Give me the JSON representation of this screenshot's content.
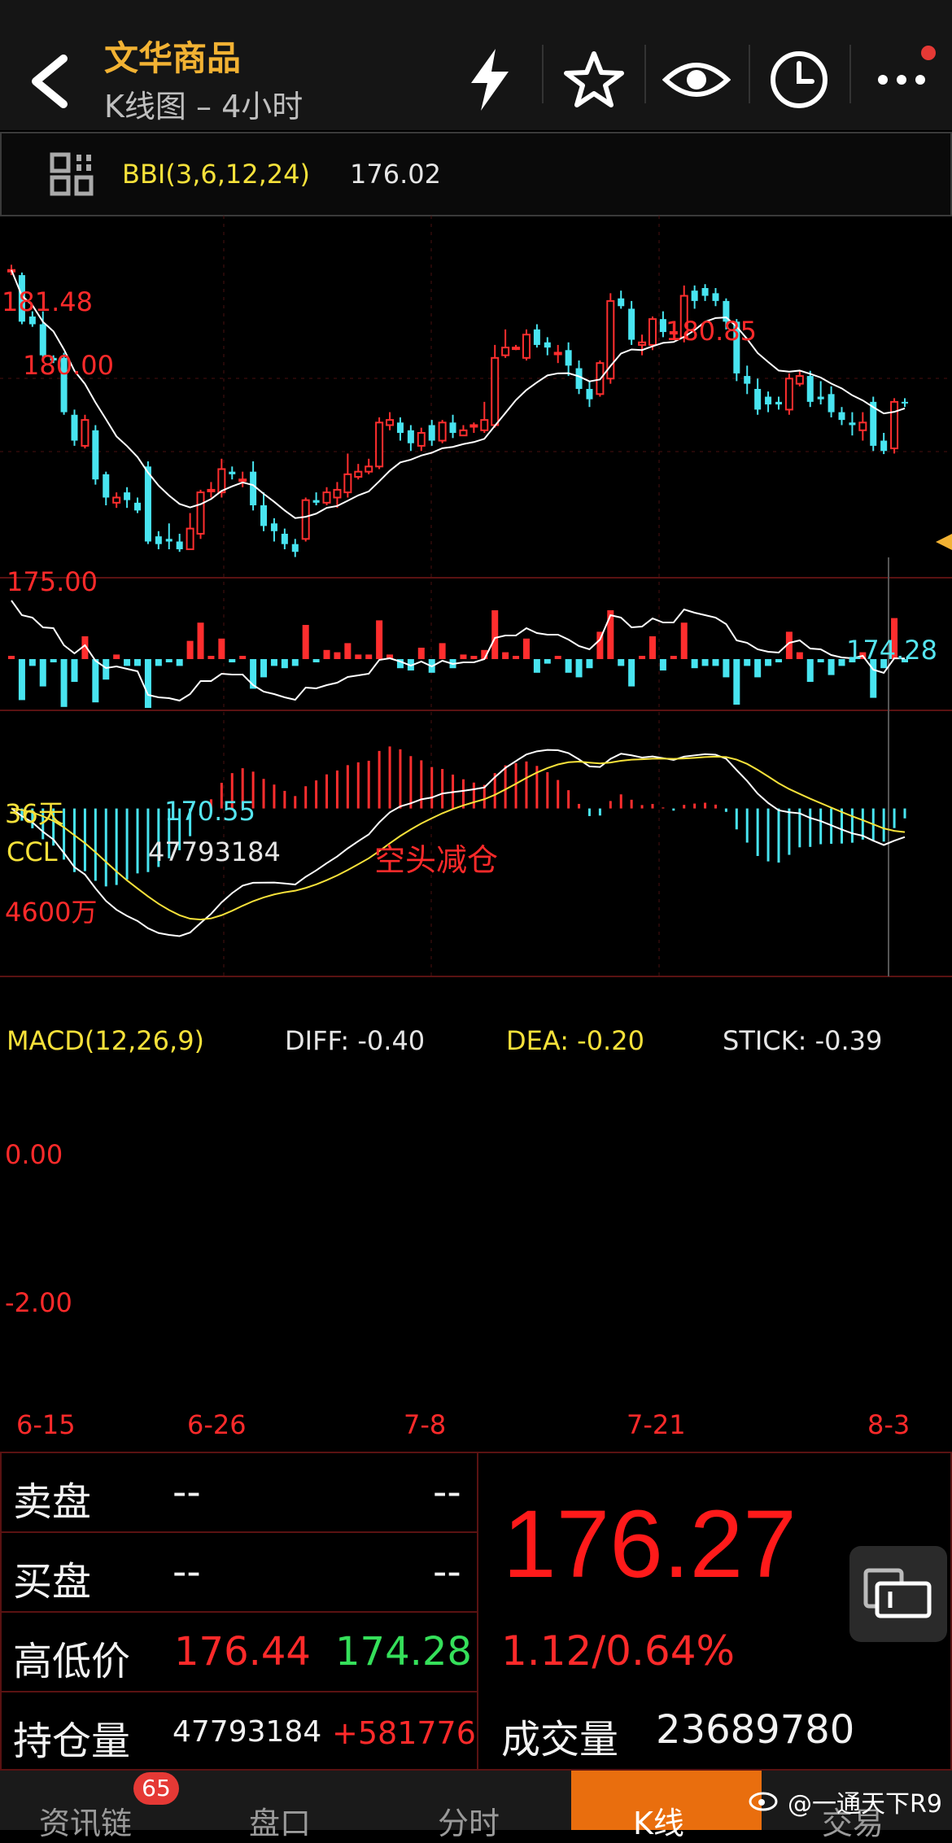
{
  "header": {
    "title": "文华商品",
    "subtitle": "K线图 – 4小时",
    "icons": [
      "back-icon",
      "flash-icon",
      "star-icon",
      "eye-icon",
      "clock-icon",
      "more-icon"
    ]
  },
  "indicator_bar": {
    "name": "BBI(3,6,12,24)",
    "value": "176.02"
  },
  "main_chart": {
    "price_labels": [
      "181.48",
      "180.00",
      "175.00"
    ],
    "high_label": "180.85",
    "low_label_1": "170.55",
    "low_label_2": "174.28",
    "period_label": "36天"
  },
  "ccl": {
    "name": "CCL",
    "value": "47793184",
    "annotation": "空头减仓",
    "axis_label": "4600万"
  },
  "macd": {
    "name": "MACD(12,26,9)",
    "diff": "DIFF: -0.40",
    "dea": "DEA: -0.20",
    "stick": "STICK: -0.39",
    "zero_label": "0.00",
    "neg_label": "-2.00"
  },
  "dates": [
    "6-15",
    "6-26",
    "7-8",
    "7-21",
    "8-3"
  ],
  "quote": {
    "sell_label": "卖盘",
    "sell_v1": "--",
    "sell_v2": "--",
    "buy_label": "买盘",
    "buy_v1": "--",
    "buy_v2": "--",
    "hl_label": "高低价",
    "high": "176.44",
    "low": "174.28",
    "oi_label": "持仓量",
    "oi": "47793184",
    "oi_change": "+581776",
    "last_price": "176.27",
    "change": "1.12/0.64%",
    "volume_label": "成交量",
    "volume": "23689780"
  },
  "tabs": {
    "news": "资讯链",
    "news_badge": "65",
    "orderbook": "盘口",
    "timeshare": "分时",
    "kline": "K线",
    "trade": "交易"
  },
  "watermark": "@一通天下R9",
  "chart_data": {
    "type": "candlestick",
    "price_ylim": [
      169.5,
      183.5
    ],
    "candles": [
      [
        181.4,
        181.4,
        181.6,
        181.2
      ],
      [
        181.2,
        179.4,
        181.3,
        179.3
      ],
      [
        179.6,
        179.3,
        179.8,
        179.2
      ],
      [
        179.3,
        178.1,
        179.8,
        178.0
      ],
      [
        178.0,
        177.9,
        178.1,
        177.8
      ],
      [
        178.0,
        175.9,
        178.2,
        175.8
      ],
      [
        175.8,
        174.8,
        176.0,
        174.6
      ],
      [
        174.6,
        175.6,
        175.8,
        174.5
      ],
      [
        175.2,
        173.3,
        175.4,
        173.1
      ],
      [
        173.5,
        172.6,
        173.6,
        172.3
      ],
      [
        172.4,
        172.6,
        172.8,
        172.2
      ],
      [
        172.8,
        172.5,
        173.0,
        172.2
      ],
      [
        172.4,
        172.1,
        172.6,
        172.0
      ],
      [
        173.8,
        170.9,
        174.0,
        170.8
      ],
      [
        171.1,
        170.8,
        171.3,
        170.6
      ],
      [
        171.0,
        170.9,
        171.6,
        170.6
      ],
      [
        170.9,
        170.6,
        171.2,
        170.5
      ],
      [
        170.6,
        171.4,
        172.0,
        170.6
      ],
      [
        171.2,
        172.8,
        172.9,
        171.0
      ],
      [
        172.9,
        172.9,
        173.2,
        172.6
      ],
      [
        172.8,
        173.7,
        174.1,
        172.6
      ],
      [
        173.6,
        173.5,
        173.8,
        173.3
      ],
      [
        173.3,
        173.3,
        173.6,
        173.0
      ],
      [
        173.6,
        172.3,
        174.0,
        172.1
      ],
      [
        172.3,
        171.5,
        172.8,
        171.3
      ],
      [
        171.6,
        171.3,
        171.8,
        170.9
      ],
      [
        171.2,
        170.8,
        171.4,
        170.6
      ],
      [
        170.8,
        170.5,
        171.0,
        170.3
      ],
      [
        171.0,
        172.5,
        172.6,
        170.9
      ],
      [
        172.5,
        172.4,
        172.8,
        172.3
      ],
      [
        172.4,
        172.8,
        173.0,
        172.3
      ],
      [
        172.6,
        172.9,
        173.2,
        172.2
      ],
      [
        172.8,
        173.5,
        174.3,
        172.6
      ],
      [
        173.4,
        173.6,
        173.9,
        173.3
      ],
      [
        173.6,
        173.8,
        174.1,
        173.5
      ],
      [
        173.8,
        175.5,
        175.7,
        173.7
      ],
      [
        175.4,
        175.6,
        175.9,
        175.2
      ],
      [
        175.5,
        175.1,
        175.7,
        174.8
      ],
      [
        175.2,
        174.7,
        175.4,
        174.4
      ],
      [
        174.6,
        175.1,
        175.3,
        174.4
      ],
      [
        175.4,
        174.8,
        175.6,
        174.6
      ],
      [
        174.8,
        175.5,
        175.6,
        174.7
      ],
      [
        175.5,
        175.1,
        175.8,
        174.9
      ],
      [
        175.0,
        175.2,
        175.4,
        175.0
      ],
      [
        175.4,
        175.4,
        175.5,
        175.1
      ],
      [
        175.2,
        175.6,
        176.3,
        175.1
      ],
      [
        175.4,
        178.0,
        178.5,
        175.3
      ],
      [
        178.1,
        178.4,
        179.1,
        178.0
      ],
      [
        178.4,
        178.4,
        178.5,
        178.3
      ],
      [
        178.0,
        178.9,
        179.1,
        177.9
      ],
      [
        179.1,
        178.5,
        179.3,
        178.4
      ],
      [
        178.6,
        178.4,
        178.8,
        178.1
      ],
      [
        178.2,
        178.2,
        178.5,
        177.8
      ],
      [
        178.3,
        177.7,
        178.6,
        177.3
      ],
      [
        177.6,
        176.8,
        177.9,
        176.6
      ],
      [
        176.8,
        176.4,
        177.1,
        176.1
      ],
      [
        176.6,
        177.8,
        177.9,
        176.5
      ],
      [
        177.2,
        180.2,
        180.5,
        177.0
      ],
      [
        180.3,
        180.0,
        180.6,
        179.9
      ],
      [
        179.9,
        178.7,
        180.2,
        178.5
      ],
      [
        178.5,
        178.6,
        178.9,
        178.1
      ],
      [
        178.5,
        179.5,
        179.6,
        178.3
      ],
      [
        179.5,
        179.0,
        179.8,
        178.8
      ],
      [
        179.0,
        179.0,
        179.3,
        178.9
      ],
      [
        178.8,
        180.4,
        180.8,
        178.6
      ],
      [
        180.6,
        180.2,
        180.8,
        179.9
      ],
      [
        180.7,
        180.4,
        180.85,
        180.2
      ],
      [
        180.5,
        180.2,
        180.7,
        180.0
      ],
      [
        180.2,
        179.4,
        180.3,
        179.1
      ],
      [
        179.4,
        177.4,
        179.5,
        177.1
      ],
      [
        177.3,
        177.0,
        177.7,
        176.6
      ],
      [
        176.8,
        176.0,
        177.2,
        175.8
      ],
      [
        176.5,
        176.2,
        176.7,
        175.9
      ],
      [
        176.3,
        176.2,
        176.5,
        176.0
      ],
      [
        176.0,
        177.2,
        177.4,
        175.8
      ],
      [
        177.0,
        177.3,
        177.5,
        176.9
      ],
      [
        177.3,
        176.3,
        177.5,
        176.1
      ],
      [
        176.5,
        176.4,
        177.1,
        176.2
      ],
      [
        176.6,
        175.9,
        176.9,
        175.7
      ],
      [
        175.9,
        175.6,
        176.1,
        175.4
      ],
      [
        175.5,
        175.4,
        175.9,
        175.0
      ],
      [
        175.2,
        175.5,
        175.9,
        174.8
      ],
      [
        176.3,
        174.6,
        176.5,
        174.4
      ],
      [
        174.8,
        174.4,
        175.1,
        174.28
      ],
      [
        174.5,
        176.3,
        176.44,
        174.3
      ],
      [
        176.3,
        176.27,
        176.44,
        176.1
      ]
    ],
    "bbi_last": 176.02,
    "open_interest_last": 47793184,
    "macd": {
      "diff": -0.4,
      "dea": -0.2,
      "stick": -0.39,
      "ylim": [
        -3.0,
        1.2
      ]
    },
    "x_ticks": [
      "6-15",
      "6-26",
      "7-8",
      "7-21",
      "8-3"
    ]
  }
}
